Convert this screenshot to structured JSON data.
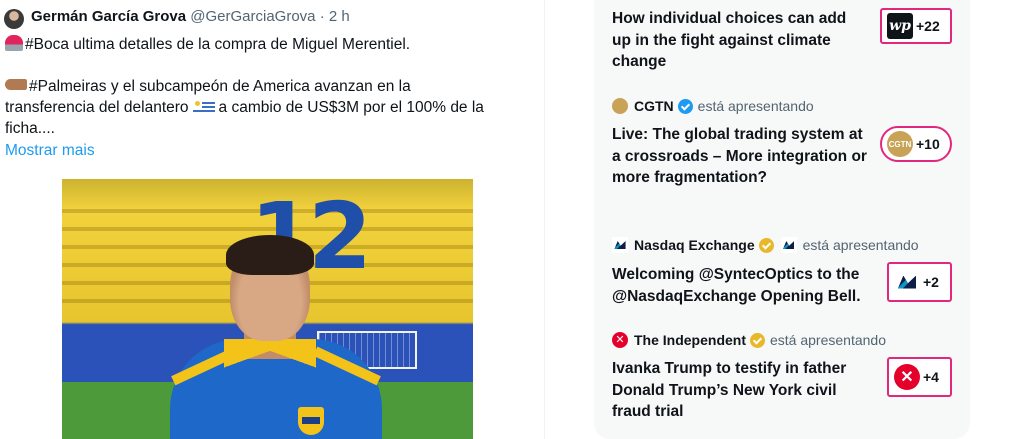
{
  "tweet": {
    "author_name": "Germán García Grova",
    "author_handle": "@GerGarciaGrova",
    "separator": "·",
    "time": "2 h",
    "lines": [
      "#Boca ultima detalles de la compra de Miguel Merentiel.",
      "#Palmeiras y el subcampeón de America avanzan en la",
      "transferencia del delantero",
      "a cambio de US$3M por el 100% de la",
      "ficha...."
    ],
    "show_more": "Mostrar mais",
    "media_number": "12"
  },
  "feed": {
    "items": [
      {
        "headline": "How individual choices can add up in the fight against climate change",
        "badge_logo": "wp",
        "badge_count": "+22"
      },
      {
        "source": "CGTN",
        "status": "está apresentando",
        "headline": "Live: The global trading system at a crossroads – More integration or more fragmentation?",
        "badge_logo": "CGTN",
        "badge_count": "+10"
      },
      {
        "source": "Nasdaq Exchange",
        "status": "está apresentando",
        "headline": "Welcoming @SyntecOptics to the @NasdaqExchange Opening Bell.",
        "badge_count": "+2"
      },
      {
        "source": "The Independent",
        "status": "está apresentando",
        "headline": "Ivanka Trump to testify in father Donald Trump’s New York civil fraud trial",
        "badge_count": "+4"
      }
    ]
  },
  "colors": {
    "link": "#1d9bf0",
    "badge_border": "#e2287d",
    "verified_blue": "#1d9bf0",
    "verified_gold": "#e8b829"
  },
  "icons": {
    "siren": "siren-icon",
    "point": "backhand-index-pointing-right-icon",
    "flag": "uruguay-flag-icon",
    "verified": "verified-badge-icon"
  }
}
